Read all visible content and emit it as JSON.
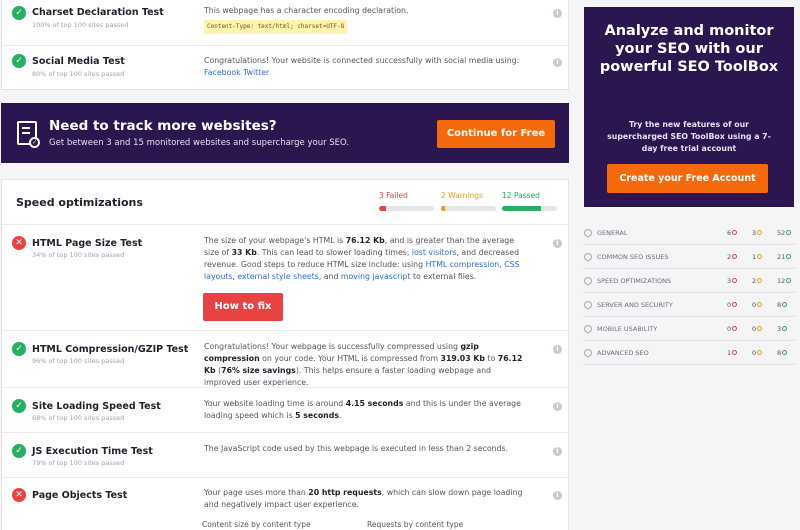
{
  "top_tests": [
    {
      "title": "Charset Declaration Test",
      "sub": "100% of top 100 sites passed",
      "desc": "This webpage has a character encoding declaration.",
      "code": "Content-Type: text/html; charset=UTF-8"
    },
    {
      "title": "Social Media Test",
      "sub": "80% of top 100 sites passed",
      "desc": "Congratulations! Your website is connected successfully with social media using:",
      "link1": "Facebook",
      "link2": "Twitter"
    }
  ],
  "banner": {
    "title": "Need to track more websites?",
    "text": "Get between 3 and 15 monitored websites and supercharge your SEO.",
    "button": "Continue for Free"
  },
  "speed": {
    "heading": "Speed optimizations",
    "failed_label": "3 Failed",
    "warnings_label": "2 Warnings",
    "passed_label": "12 Passed",
    "failed_fraction": 0.13,
    "warnings_fraction": 0.07,
    "passed_fraction": 0.71,
    "colors": {
      "failed": "#e84343",
      "warning": "#f39c12",
      "passed": "#27ae60"
    }
  },
  "tests": {
    "html_size": {
      "title": "HTML Page Size Test",
      "sub": "34% of top 100 sites passed",
      "p1": "The size of your webpage's HTML is ",
      "b1": "76.12 Kb",
      "p2": ", and is greater than the average size of ",
      "b2": "33 Kb",
      "p3": ". This can lead to slower loading times, ",
      "l1": "lost visitors",
      "p4": ", and decreased revenue. Good steps to reduce HTML size include: using ",
      "l2": "HTML compression",
      "p5": ", ",
      "l3": "CSS layouts",
      "p6": ", ",
      "l4": "external style sheets",
      "p7": ", and ",
      "l5": "moving javascript",
      "p8": " to external files.",
      "button": "How to fix"
    },
    "gzip": {
      "title": "HTML Compression/GZIP Test",
      "sub": "96% of top 100 sites passed",
      "p1": "Congratulations! Your webpage is successfully compressed using ",
      "b1": "gzip compression",
      "p2": " on your code. Your HTML is compressed from ",
      "b2": "319.03 Kb",
      "p3": " to ",
      "b3": "76.12 Kb",
      "p4": " (",
      "b4": "76% size savings",
      "p5": "). This helps ensure a faster loading webpage and improved user experience."
    },
    "loading": {
      "title": "Site Loading Speed Test",
      "sub": "68% of top 100 sites passed",
      "p1": "Your website loading time is around ",
      "b1": "4.15 seconds",
      "p2": " and this is under the average loading speed which is ",
      "b2": "5 seconds",
      "p3": "."
    },
    "js": {
      "title": "JS Execution Time Test",
      "sub": "79% of top 100 sites passed",
      "desc": "The JavaScript code used by this webpage is executed in less than 2 seconds."
    },
    "objects": {
      "title": "Page Objects Test",
      "p1": "Your page uses more than ",
      "b1": "20 http requests",
      "p2": ", which can slow down page loading and negatively impact user experience.",
      "col1": "Content size by content type",
      "col2": "Requests by content type"
    }
  },
  "promo": {
    "headline": "Analyze and monitor your SEO with our powerful SEO ToolBox",
    "text": "Try the new features of our supercharged SEO ToolBox using a 7-day free trial account",
    "button": "Create your Free Account"
  },
  "side_stats": [
    {
      "label": "GENERAL",
      "red": "6",
      "orange": "3",
      "green": "52"
    },
    {
      "label": "COMMON SEO ISSUES",
      "red": "2",
      "orange": "1",
      "green": "21"
    },
    {
      "label": "SPEED OPTIMIZATIONS",
      "red": "3",
      "orange": "2",
      "green": "12"
    },
    {
      "label": "SERVER AND SECURITY",
      "red": "0",
      "orange": "0",
      "green": "8"
    },
    {
      "label": "MOBILE USABILITY",
      "red": "0",
      "orange": "0",
      "green": "3"
    },
    {
      "label": "ADVANCED SEO",
      "red": "1",
      "orange": "0",
      "green": "8"
    }
  ],
  "icons": {
    "pass": "check-icon",
    "fail": "x-icon",
    "info": "info-icon",
    "tracking": "document-check-icon"
  }
}
